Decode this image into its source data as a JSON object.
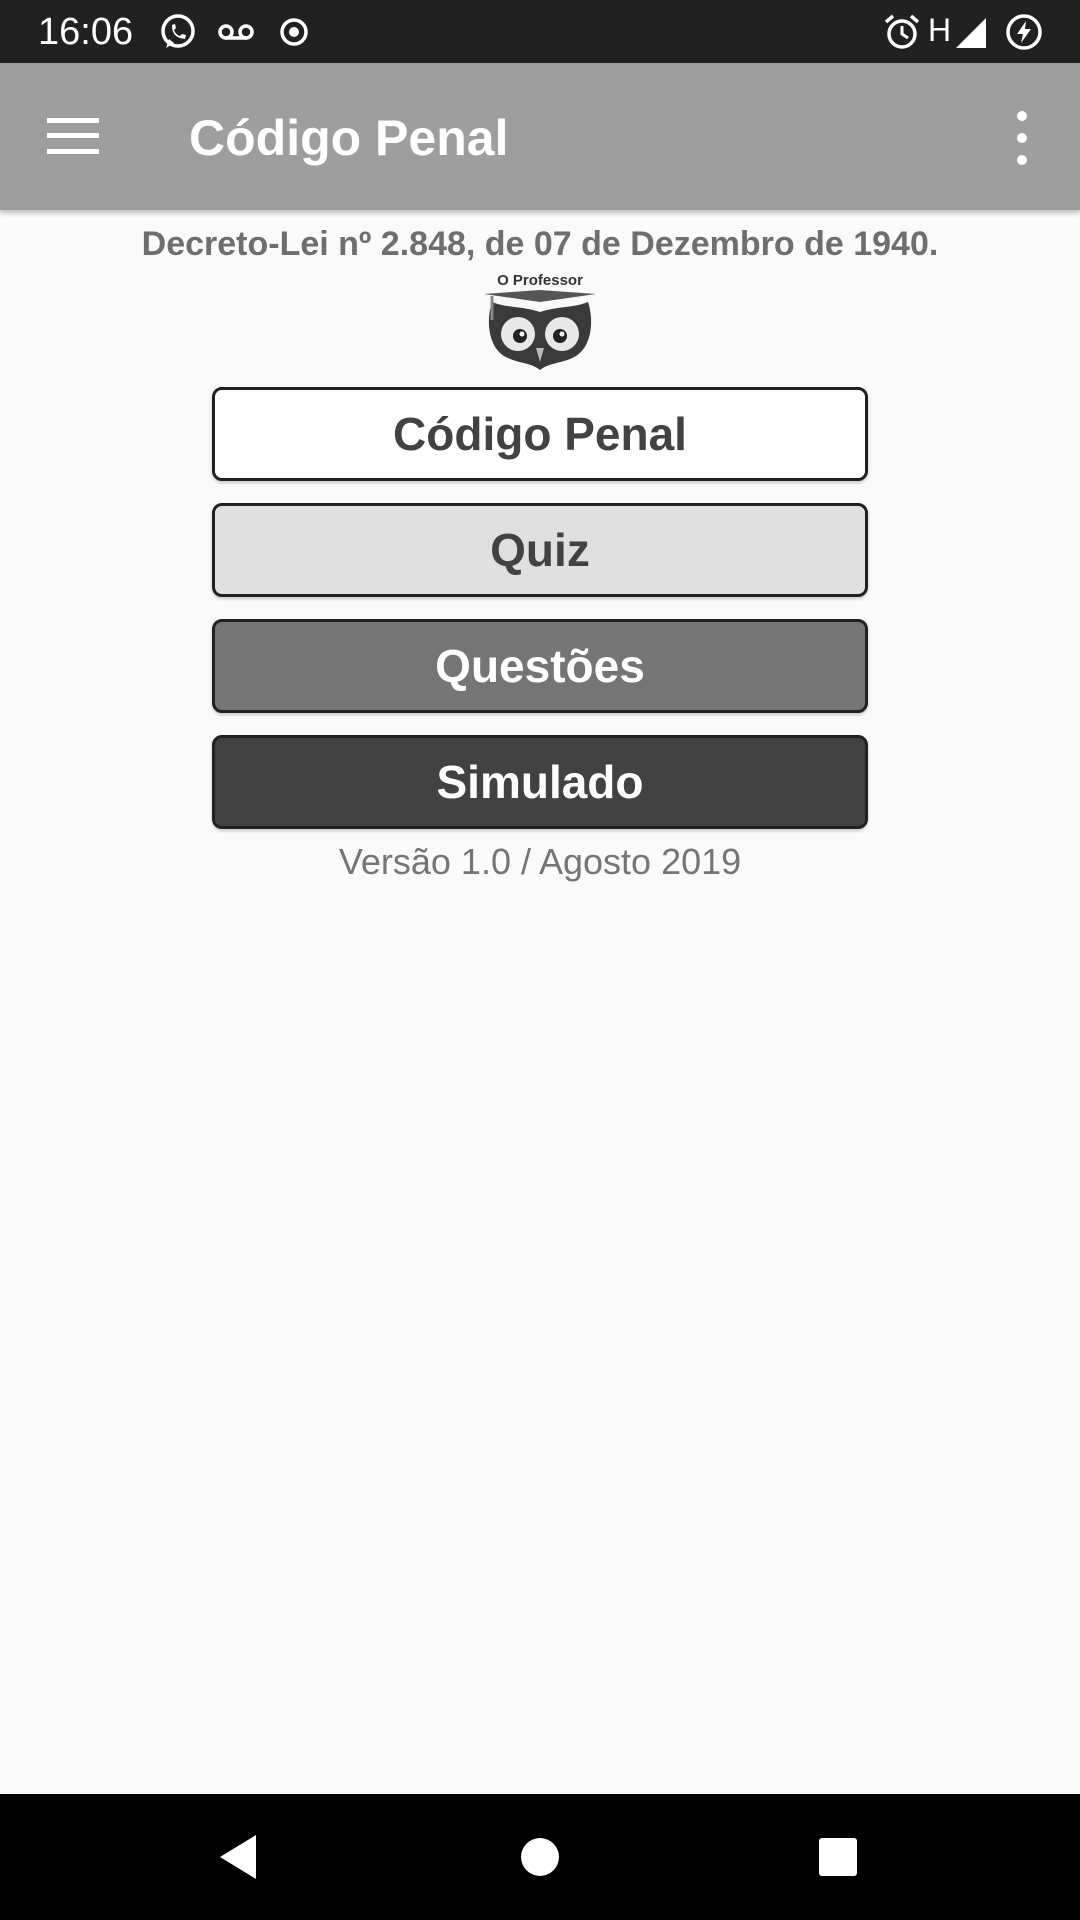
{
  "status_bar": {
    "time": "16:06",
    "network_label": "H",
    "icons": [
      "whatsapp-icon",
      "voicemail-icon",
      "record-icon",
      "alarm-icon",
      "signal-icon",
      "battery-charging-icon"
    ]
  },
  "app_bar": {
    "title": "Código Penal",
    "menu_icon": "hamburger-menu-icon",
    "overflow_icon": "more-vert-icon"
  },
  "main": {
    "subtitle": "Decreto-Lei nº 2.848, de 07 de Dezembro de 1940.",
    "logo_text": "O Professor",
    "buttons": [
      {
        "label": "Código Penal"
      },
      {
        "label": "Quiz"
      },
      {
        "label": "Questões"
      },
      {
        "label": "Simulado"
      }
    ],
    "version": "Versão 1.0 / Agosto 2019"
  },
  "nav_bar": {
    "icons": [
      "back-icon",
      "home-icon",
      "recents-icon"
    ]
  },
  "colors": {
    "status_bar": "#212121",
    "app_bar": "#9e9e9e",
    "background": "#fafafa",
    "button_1": "#ffffff",
    "button_2": "#e0e0e0",
    "button_3": "#757575",
    "button_4": "#424242"
  }
}
